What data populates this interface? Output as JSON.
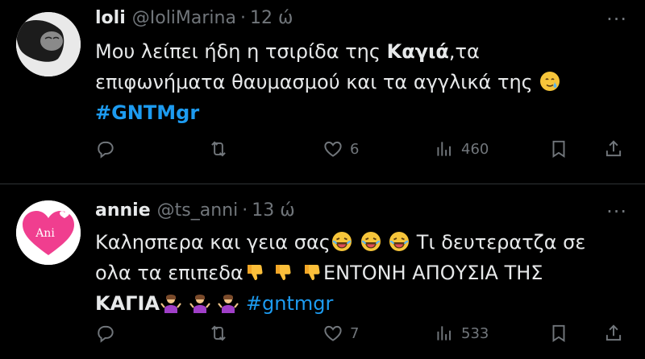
{
  "tweets": [
    {
      "name": "loli",
      "handle": "@IoliMarina",
      "dot": "·",
      "time": "12 ώ",
      "more": "···",
      "line1_a": "Μου λείπει ήδη η τσιρίδα της ",
      "line1_bold": "Καγιά",
      "line1_b": ",τα",
      "line2": "επιφωνήματα θαυμασμού και τα αγγλικά της ",
      "hashtag": "#GNTMgr",
      "likes": "6",
      "views": "460"
    },
    {
      "name": "annie",
      "handle": "@ts_anni",
      "dot": "·",
      "time": "13 ώ",
      "more": "···",
      "avatar_text": "Ani",
      "line1_a": "Καλησπερα και γεια σας",
      "line1_b": "Τι δευτερατζα σε",
      "line2_a": "ολα τα επιπεδα",
      "line2_b": "ΕΝΤΟΝΗ ΑΠΟΥΣΙΑ ΤΗΣ",
      "line3_bold": "ΚΑΓΙΑ",
      "hashtag": "#gntmgr",
      "likes": "7",
      "views": "533"
    }
  ],
  "icons": {
    "reply": "reply-icon",
    "retweet": "retweet-icon",
    "like": "heart-icon",
    "views": "views-icon",
    "bookmark": "bookmark-icon",
    "share": "share-icon",
    "emoji_tear": "smiling-face-with-tear-emoji",
    "emoji_laugh": "face-with-tears-of-joy-emoji",
    "emoji_thumbs": "thumbs-down-emoji",
    "emoji_shrug": "person-shrugging-emoji"
  },
  "colors": {
    "background": "#000000",
    "text": "#e7e9ea",
    "muted": "#71767b",
    "link": "#1d9bf0",
    "divider": "#2f3336"
  }
}
